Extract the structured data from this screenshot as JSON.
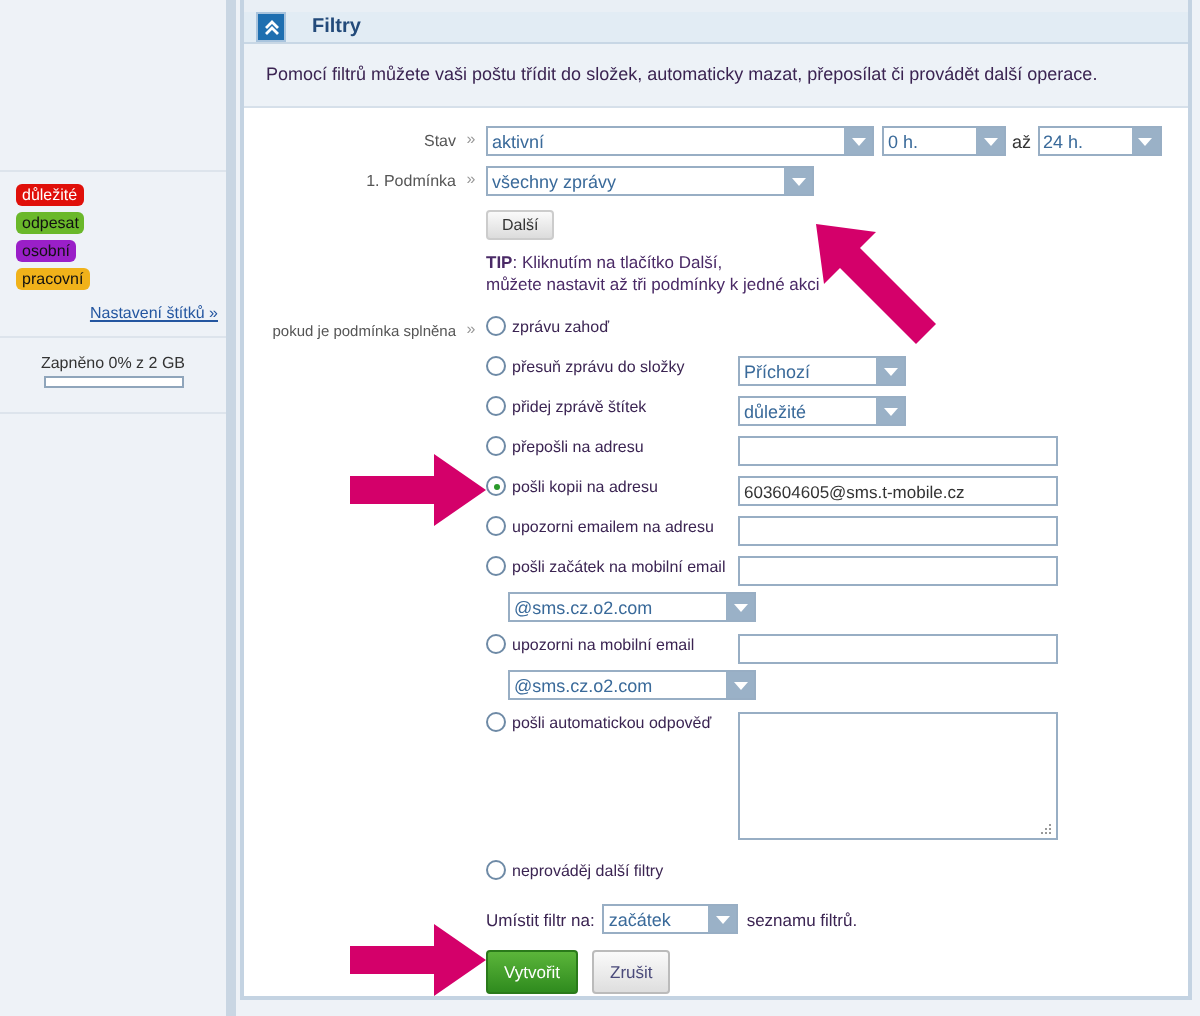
{
  "sidebar": {
    "tags": [
      {
        "label": "důležité",
        "color": "#e0100a"
      },
      {
        "label": "odpesat",
        "color": "#6ab82a"
      },
      {
        "label": "osobní",
        "color": "#9a1fc8"
      },
      {
        "label": "pracovní",
        "color": "#f0b21a"
      }
    ],
    "tags_link": "Nastavení štítků »",
    "quota": {
      "label": "Zapněno 0% z 2 GB",
      "level": 0
    }
  },
  "panel": {
    "title": "Filtry",
    "description": "Pomocí filtrů můžete vaši poštu třídit do složek, automaticky mazat, přeposílat či provádět další operace.",
    "state": {
      "label": "Stav",
      "arrow": "»",
      "value": "aktivní",
      "from": "0 h.",
      "to_label": "až",
      "to": "24 h."
    },
    "condition": {
      "label": "1. Podmínka",
      "arrow": "»",
      "value": "všechny zprávy"
    },
    "next_button": "Další",
    "tip": [
      "**TIP**: Kliknutím na tlačítko Další,",
      "můžete nastavit až tři podmínky k jedné akci"
    ],
    "actions_label": "pokud je podmínka splněna",
    "actions_arrow": "»",
    "actions": [
      {
        "kind": "plain",
        "label": "zprávu zahoď",
        "selected": false
      },
      {
        "kind": "select",
        "label": "přesuň zprávu do složky",
        "selected": false,
        "value": "Příchozí"
      },
      {
        "kind": "select",
        "label": "přidej zprávě štítek",
        "selected": false,
        "value": "důležité"
      },
      {
        "kind": "input",
        "label": "přepošli na adresu",
        "selected": false
      },
      {
        "kind": "input",
        "label": "pošli kopii na adresu",
        "selected": true,
        "value": "603604605@sms.t-mobile.cz"
      },
      {
        "kind": "input",
        "label": "upozorni emailem na adresu",
        "selected": false
      },
      {
        "kind": "input_select",
        "label": "pošli začátek na mobilní email",
        "selected": false,
        "option": "@sms.cz.o2.com"
      },
      {
        "kind": "input_select",
        "label": "upozorni na mobilní email",
        "selected": false,
        "option": "@sms.cz.o2.com"
      },
      {
        "kind": "textarea",
        "label": "pošli automatickou odpověď",
        "selected": false
      },
      {
        "kind": "plain",
        "label": "neprováděj další filtry",
        "selected": false
      }
    ],
    "placement": {
      "before": "Umístit filtr na:",
      "value": "začátek",
      "after": "seznamu filtrů."
    },
    "buttons": [
      {
        "label": "Vytvořit",
        "kind": "primary"
      },
      {
        "label": "Zrušit",
        "kind": "secondary"
      }
    ]
  }
}
